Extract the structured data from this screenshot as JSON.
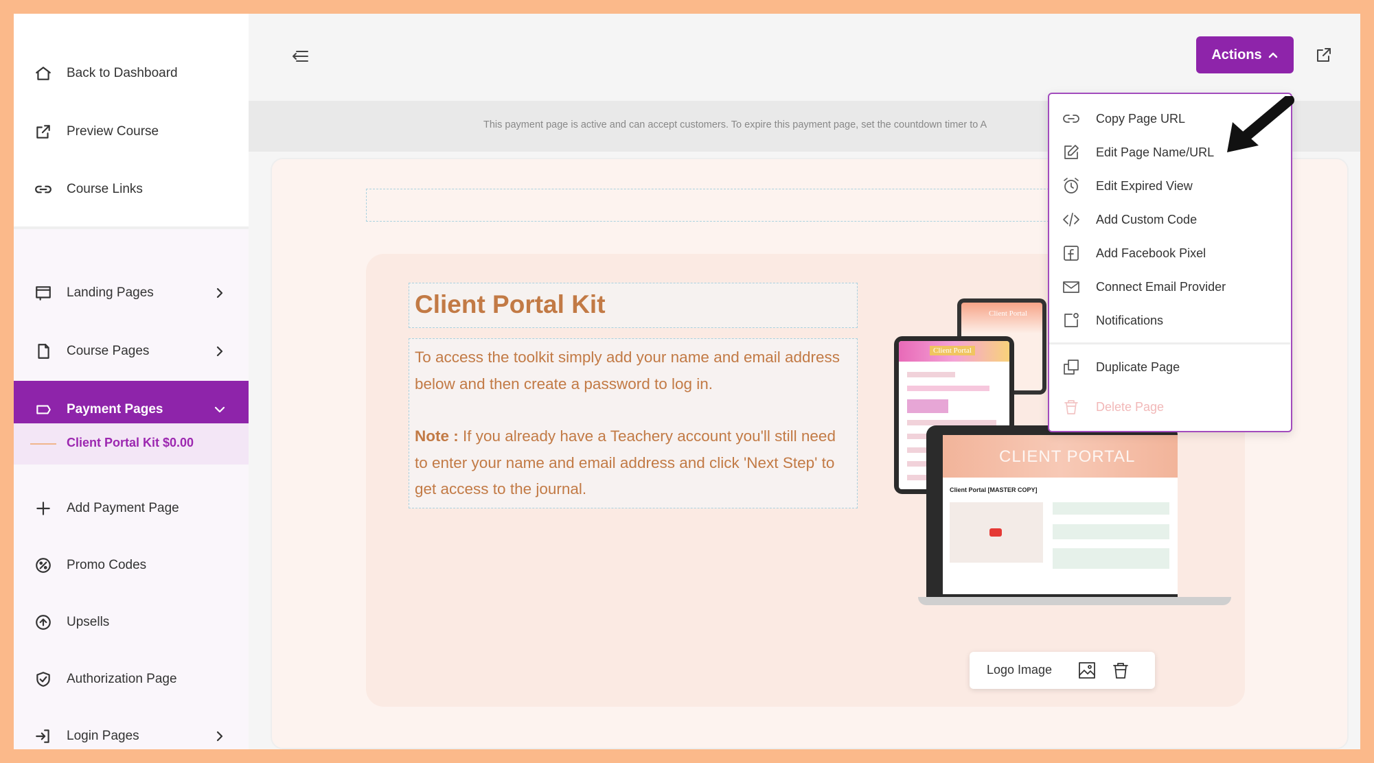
{
  "sidebar": {
    "top_items": [
      {
        "label": "Back to Dashboard",
        "icon": "home-icon"
      },
      {
        "label": "Preview Course",
        "icon": "external-link-icon"
      },
      {
        "label": "Course Links",
        "icon": "link-icon"
      }
    ],
    "items": [
      {
        "label": "Landing Pages",
        "icon": "layout-icon"
      },
      {
        "label": "Course Pages",
        "icon": "file-icon"
      },
      {
        "label": "Payment Pages",
        "icon": "tag-icon"
      },
      {
        "label": "Add Payment Page",
        "icon": "plus-icon"
      },
      {
        "label": "Promo Codes",
        "icon": "percent-icon"
      },
      {
        "label": "Upsells",
        "icon": "arrow-up-circle-icon"
      },
      {
        "label": "Authorization Page",
        "icon": "shield-check-icon"
      },
      {
        "label": "Login Pages",
        "icon": "login-icon"
      }
    ],
    "active_subitem": "Client Portal Kit $0.00",
    "colors": {
      "active_bg": "#8e24aa",
      "subitem_bg": "#f3e6f6",
      "subitem_text": "#9c27b0"
    }
  },
  "header": {
    "actions_label": "Actions",
    "notice": "This payment page is active and can accept customers. To expire this payment page, set the countdown timer to A"
  },
  "actions_menu": {
    "items": [
      {
        "label": "Copy Page URL",
        "icon": "link-icon"
      },
      {
        "label": "Edit Page Name/URL",
        "icon": "edit-icon"
      },
      {
        "label": "Edit Expired View",
        "icon": "alarm-clock-icon"
      },
      {
        "label": "Add Custom Code",
        "icon": "code-icon"
      },
      {
        "label": "Add Facebook Pixel",
        "icon": "facebook-icon"
      },
      {
        "label": "Connect Email Provider",
        "icon": "mail-icon"
      },
      {
        "label": "Notifications",
        "icon": "notification-icon"
      },
      {
        "label": "Duplicate Page",
        "icon": "copy-icon"
      },
      {
        "label": "Delete Page",
        "icon": "trash-icon"
      }
    ]
  },
  "content": {
    "title": "Client Portal Kit",
    "paragraph1": "To access the toolkit simply add your name and email address below and then create a password to log in.",
    "note_label": "Note :",
    "note_text": " If you already have a Teachery account you'll still need to enter your name and email address and click 'Next Step' to get access to the journal.",
    "logo_chip_label": "Logo Image",
    "mockup": {
      "tablet_back_label": "Client Portal",
      "tablet_label": "Client Portal",
      "laptop_header": "CLIENT PORTAL",
      "laptop_subtitle": "Client Portal [MASTER COPY]"
    },
    "colors": {
      "accent_text": "#c27a45",
      "canvas_bg": "#fdf3ef"
    }
  }
}
